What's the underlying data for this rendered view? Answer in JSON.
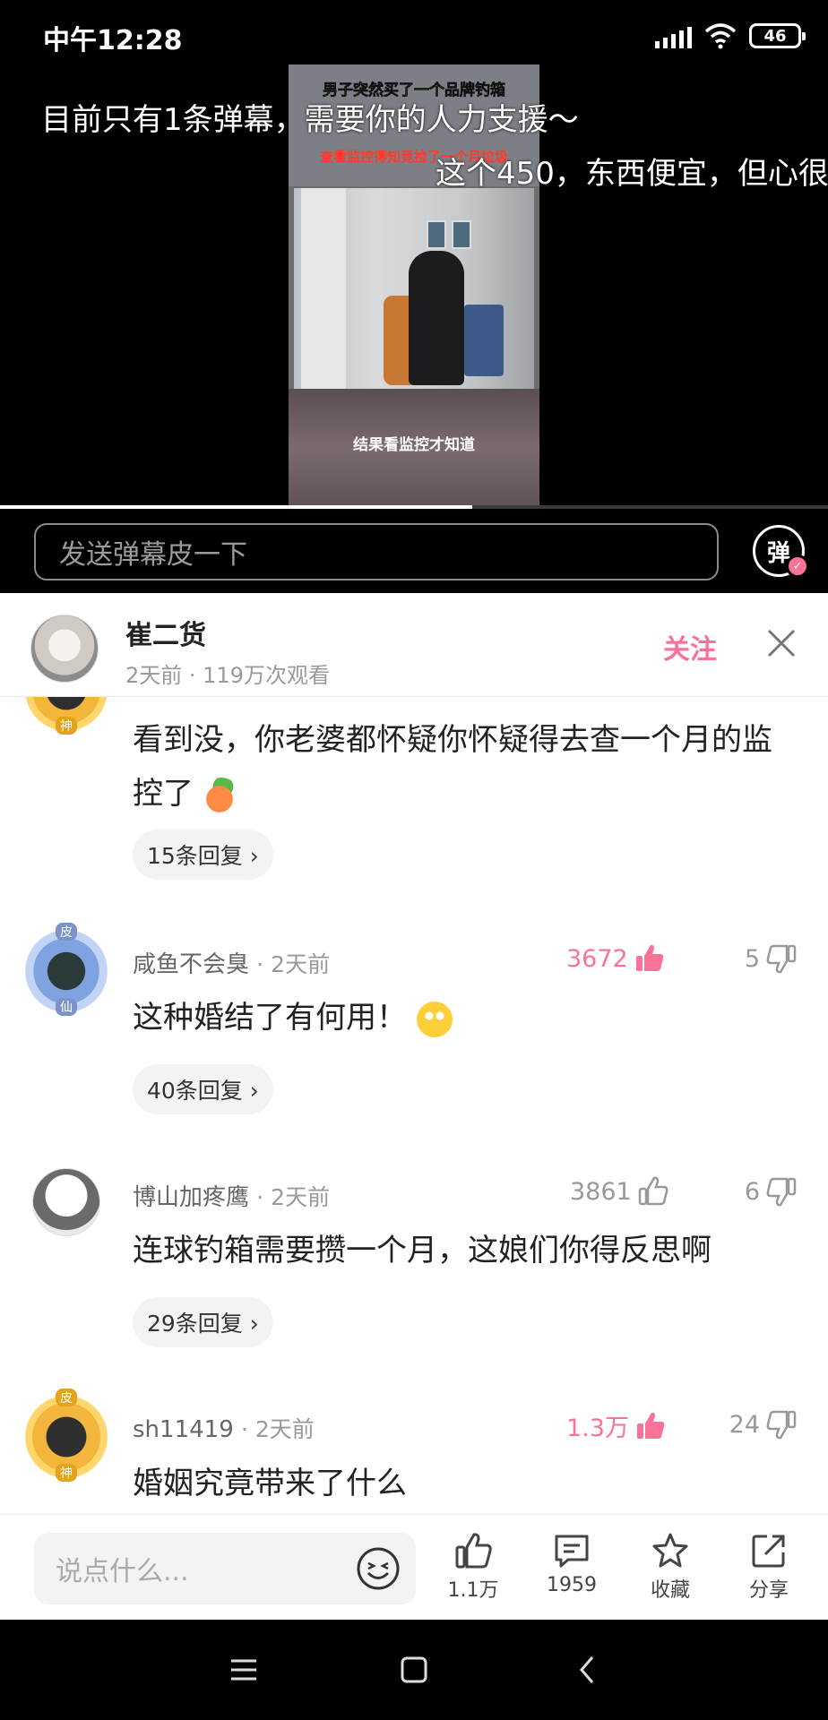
{
  "status_bar": {
    "time": "中午12:28",
    "battery": "46"
  },
  "video": {
    "overlay_title": "男子突然买了一个品牌钓箱",
    "overlay_subtitle": "查看监控得知竟捡了一个月垃圾",
    "caption": "结果看监控才知道",
    "danmaku": [
      "目前只有1条弹幕，需要你的人力支援～",
      "这个450，东西便宜，但心很"
    ],
    "progress_percent": 57,
    "danmaku_input_placeholder": "发送弹幕皮一下",
    "danmaku_toggle_label": "弹"
  },
  "author": {
    "name": "崔二货",
    "meta": "2天前 · 119万次观看",
    "follow_label": "关注"
  },
  "comments": [
    {
      "user": "",
      "time": "",
      "text": "看到没，你老婆都怀疑你怀疑得去查一个月的监控了",
      "replies": "15条回复 ›",
      "badge_label": "神"
    },
    {
      "user": "咸鱼不会臭",
      "time": "· 2天前",
      "likes": "3672",
      "dislikes": "5",
      "text": "这种婚结了有何用！",
      "replies": "40条回复 ›",
      "badge_label_top": "皮",
      "badge_label": "仙"
    },
    {
      "user": "博山加疼鹰",
      "time": "· 2天前",
      "likes": "3861",
      "dislikes": "6",
      "text": "连球钓箱需要攒一个月，这娘们你得反思啊",
      "replies": "29条回复 ›"
    },
    {
      "user": "sh11419",
      "time": "· 2天前",
      "likes": "1.3万",
      "dislikes": "24",
      "text": "婚姻究竟带来了什么",
      "badge_label_top": "皮",
      "badge_label": "神"
    }
  ],
  "action_bar": {
    "input_placeholder": "说点什么...",
    "like_count": "1.1万",
    "comment_count": "1959",
    "favorite_label": "收藏",
    "share_label": "分享"
  },
  "colors": {
    "accent": "#fb7299",
    "muted": "#999999"
  }
}
